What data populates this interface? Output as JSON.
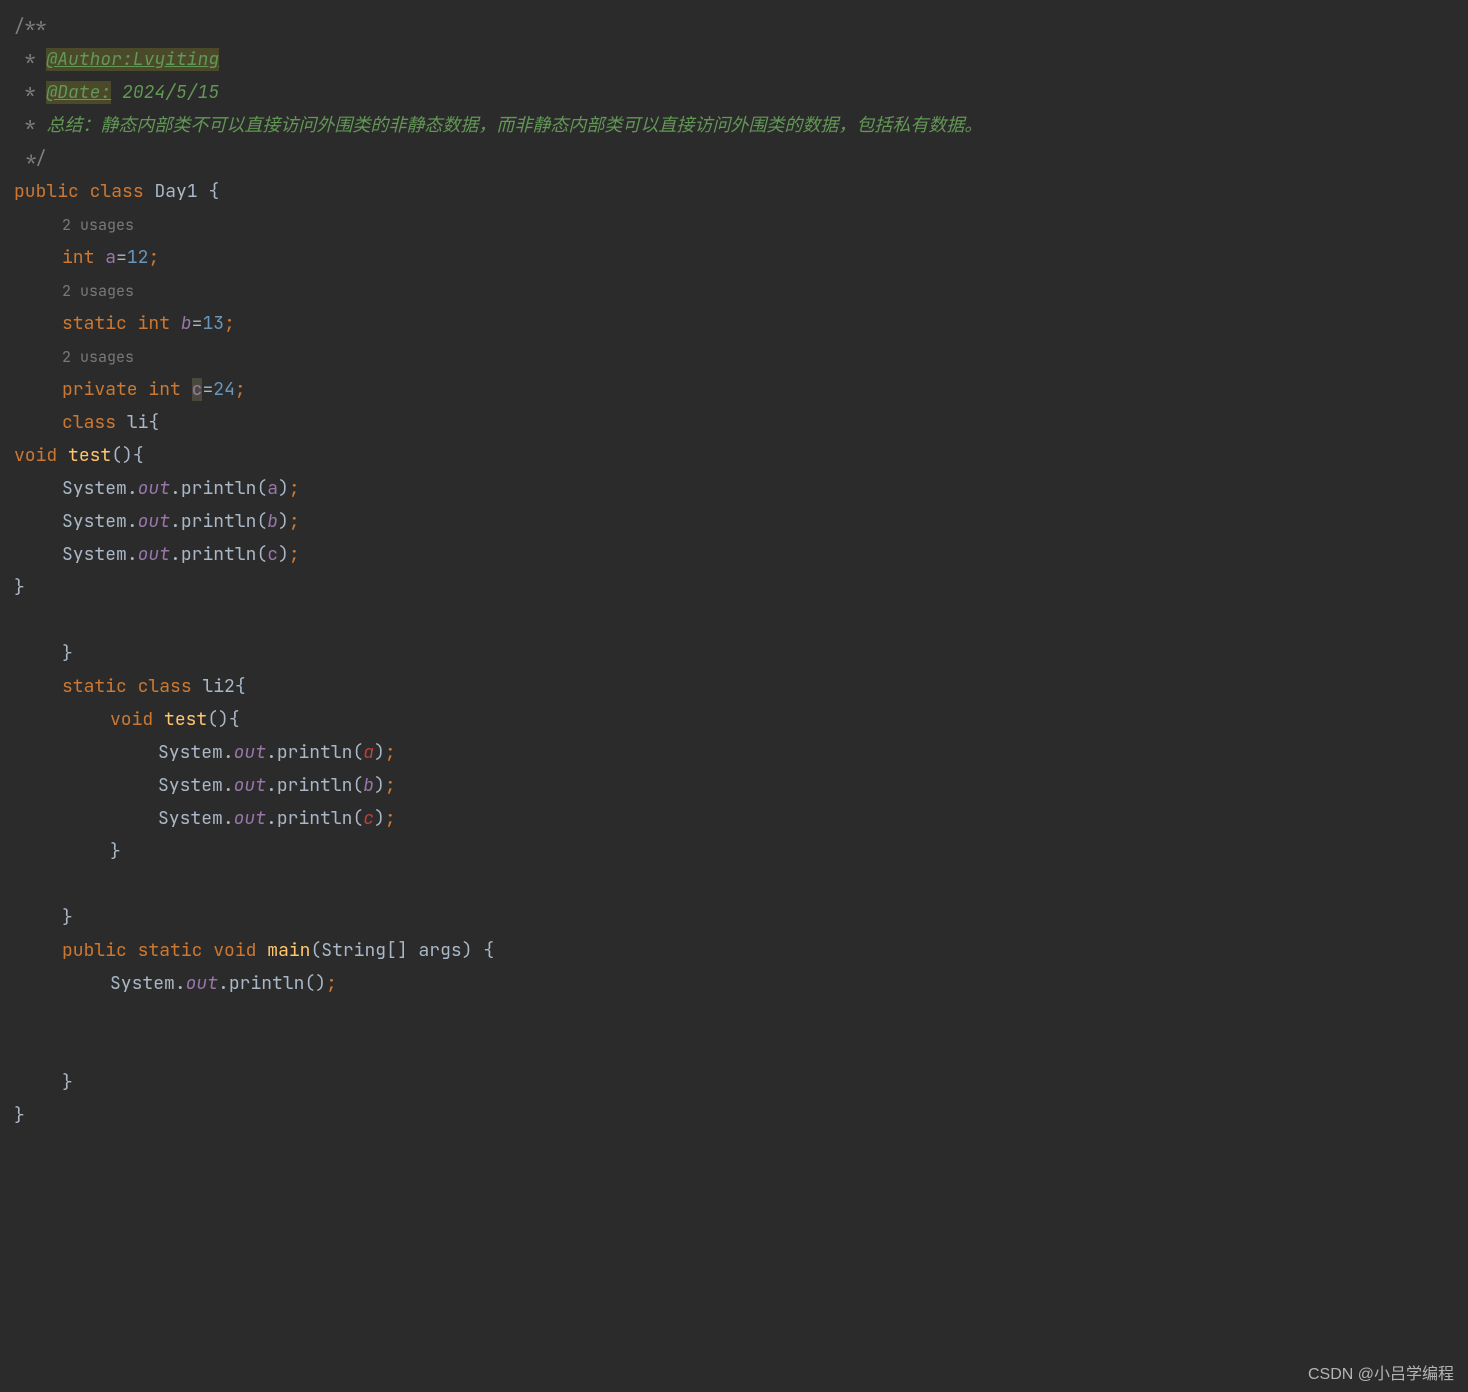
{
  "doc": {
    "open": "/**",
    "author_star": " * ",
    "author_tag": "@Author:Lvyiting",
    "date_star": " * ",
    "date_tag": "@Date:",
    "date_val": " 2024/5/15",
    "summary_star": " * ",
    "summary_text": "总结：静态内部类不可以直接访问外围类的非静态数据，而非静态内部类可以直接访问外围类的数据，包括私有数据。",
    "close": " */"
  },
  "cls": {
    "public": "public",
    "class_kw": "class",
    "name": "Day1",
    "brace_open": "{",
    "brace_close": "}"
  },
  "hints": {
    "usages": "2 usages"
  },
  "fields": {
    "int_kw": "int",
    "a_name": "a",
    "a_val": "12",
    "static_kw": "static",
    "b_name": "b",
    "b_val": "13",
    "private_kw": "private",
    "c_name": "c",
    "c_val": "24",
    "eq": "=",
    "semi": ";"
  },
  "inner1": {
    "class_kw": "class",
    "name": "li",
    "brace_open": "{",
    "brace_close": "}"
  },
  "method": {
    "void_kw": "void",
    "test_name": "test",
    "parens": "()",
    "brace_open": "{",
    "brace_close": "}"
  },
  "sysout": {
    "system": "System",
    "dot": ".",
    "out": "out",
    "println": "println",
    "open_p": "(",
    "close_p": ")",
    "semi": ";",
    "a": "a",
    "b": "b",
    "c": "c"
  },
  "inner2": {
    "static_kw": "static",
    "class_kw": "class",
    "name": "li2",
    "brace_open": "{",
    "brace_close": "}"
  },
  "main": {
    "public_kw": "public",
    "static_kw": "static",
    "void_kw": "void",
    "name": "main",
    "param_type": "String[]",
    "param_name": "args",
    "brace_open": "{",
    "brace_close": "}"
  },
  "watermark": "CSDN @小吕学编程"
}
